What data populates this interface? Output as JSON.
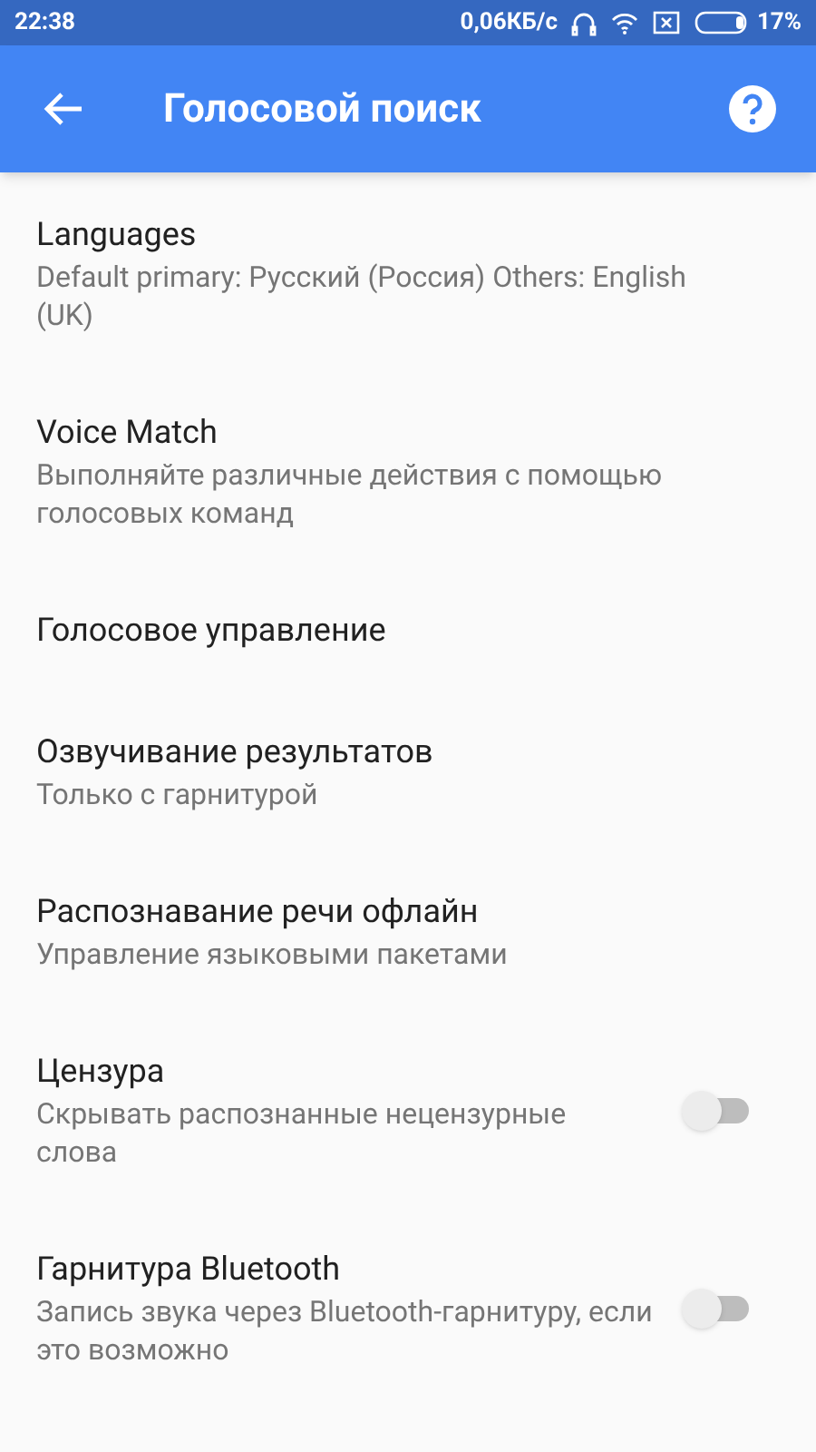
{
  "status_bar": {
    "time": "22:38",
    "speed": "0,06КБ/с",
    "battery": "17%"
  },
  "app_bar": {
    "title": "Голосовой поиск"
  },
  "settings": [
    {
      "kind": "link",
      "title": "Languages",
      "subtitle": "Default primary: Русский (Россия) Others: English (UK)"
    },
    {
      "kind": "link",
      "title": "Voice Match",
      "subtitle": "Выполняйте различные действия с помощью голосовых команд"
    },
    {
      "kind": "link",
      "title": "Голосовое управление"
    },
    {
      "kind": "link",
      "title": "Озвучивание результатов",
      "subtitle": "Только с гарнитурой"
    },
    {
      "kind": "link",
      "title": "Распознавание речи офлайн",
      "subtitle": "Управление языковыми пакетами"
    },
    {
      "kind": "switch",
      "title": "Цензура",
      "subtitle": "Скрывать распознанные нецензурные слова",
      "on": false
    },
    {
      "kind": "switch",
      "title": "Гарнитура Bluetooth",
      "subtitle": "Запись звука через Bluetooth-гарнитуру, если это возможно",
      "on": false
    }
  ]
}
